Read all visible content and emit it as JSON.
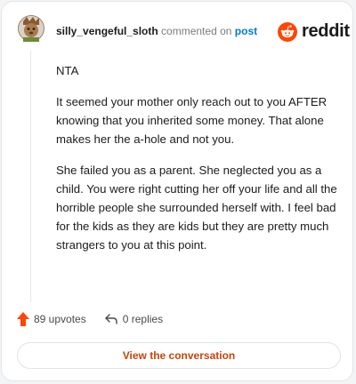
{
  "header": {
    "username": "silly_vengeful_sloth",
    "commented_text": "commented on",
    "post_link": "post",
    "brand": "reddit"
  },
  "comment": {
    "paragraphs": [
      "NTA",
      "It seemed your mother only reach out to you AFTER knowing that you inherited some money. That alone makes her the a-hole and not you.",
      "She failed you as a parent. She neglected you as a child. You were right cutting her off your life and all the horrible people she surrounded herself with. I feel bad for the kids as they are kids but they are pretty much strangers to you at this point."
    ]
  },
  "actions": {
    "upvotes": "89 upvotes",
    "replies": "0 replies"
  },
  "footer": {
    "view_button": "View the conversation"
  },
  "colors": {
    "upvote": "#ff4500",
    "link": "#0079d3",
    "reddit_orange": "#ff4500",
    "button_text": "#c7430a"
  },
  "icons": [
    "avatar",
    "reddit-logo-icon",
    "upvote-arrow-icon",
    "reply-arrow-icon"
  ]
}
